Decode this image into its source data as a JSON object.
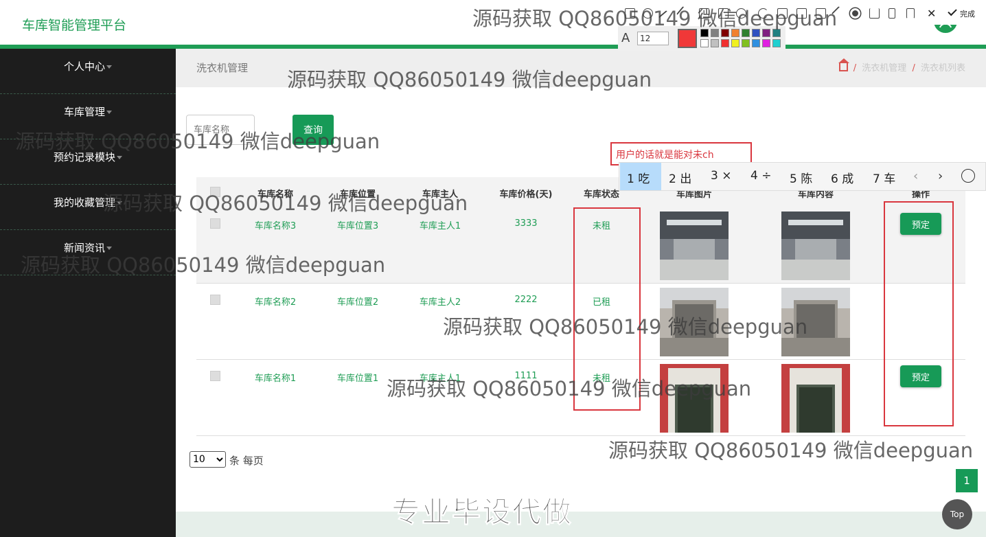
{
  "app": {
    "title": "车库智能管理平台"
  },
  "sidebar": {
    "items": [
      {
        "label": "个人中心"
      },
      {
        "label": "车库管理"
      },
      {
        "label": "预约记录模块"
      },
      {
        "label": "我的收藏管理"
      },
      {
        "label": "新闻资讯"
      }
    ]
  },
  "header": {
    "title": "洗衣机管理",
    "breadcrumb": [
      "洗衣机管理",
      "洗衣机列表"
    ]
  },
  "search": {
    "placeholder": "车库名称",
    "button_label": "查询"
  },
  "table": {
    "columns": [
      "车库名称",
      "车库位置",
      "车库主人",
      "车库价格(天)",
      "车库状态",
      "车库图片",
      "车库内容",
      "操作"
    ],
    "rows": [
      {
        "name": "车库名称3",
        "location": "车库位置3",
        "owner": "车库主人1",
        "price": "3333",
        "status": "未租",
        "action": "预定"
      },
      {
        "name": "车库名称2",
        "location": "车库位置2",
        "owner": "车库主人2",
        "price": "2222",
        "status": "已租",
        "action": ""
      },
      {
        "name": "车库名称1",
        "location": "车库位置1",
        "owner": "车库主人1",
        "price": "1111",
        "status": "未租",
        "action": "预定"
      }
    ]
  },
  "pagination": {
    "page_size": "10",
    "page_size_options": [
      "10"
    ],
    "per_page_label": "条 每页",
    "current_page": "1",
    "top_label": "Top"
  },
  "screenshot_tool": {
    "font_size": "12",
    "done_label": "完成",
    "current_color": "#f03838"
  },
  "ime": {
    "composition": "用户的话就是能对未ch",
    "candidates": [
      "1 吃",
      "2 出",
      "3 ×",
      "4 ÷",
      "5 陈",
      "6 成",
      "7 车"
    ]
  },
  "watermark": {
    "text": "源码获取 QQ86050149 微信deepguan"
  },
  "promo": {
    "text": "专业毕设代做"
  },
  "colors": {
    "accent": "#1f9d55",
    "sidebar_bg": "#1d1d1d",
    "annotation_red": "#d9363e"
  }
}
